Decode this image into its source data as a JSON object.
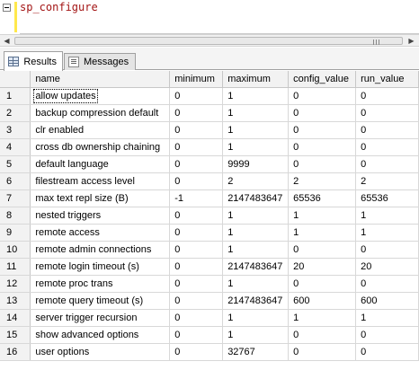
{
  "editor": {
    "collapse_symbol": "-",
    "query_text": "sp_configure"
  },
  "scrollbar": {
    "left_arrow": "◀",
    "right_arrow": "▶"
  },
  "tabs": [
    {
      "label": "Results",
      "icon": "grid-icon",
      "active": true
    },
    {
      "label": "Messages",
      "icon": "messages-icon",
      "active": false
    }
  ],
  "grid": {
    "columns": [
      "",
      "name",
      "minimum",
      "maximum",
      "config_value",
      "run_value"
    ],
    "rows": [
      [
        "1",
        "allow updates",
        "0",
        "1",
        "0",
        "0"
      ],
      [
        "2",
        "backup compression default",
        "0",
        "1",
        "0",
        "0"
      ],
      [
        "3",
        "clr enabled",
        "0",
        "1",
        "0",
        "0"
      ],
      [
        "4",
        "cross db ownership chaining",
        "0",
        "1",
        "0",
        "0"
      ],
      [
        "5",
        "default language",
        "0",
        "9999",
        "0",
        "0"
      ],
      [
        "6",
        "filestream access level",
        "0",
        "2",
        "2",
        "2"
      ],
      [
        "7",
        "max text repl size (B)",
        "-1",
        "2147483647",
        "65536",
        "65536"
      ],
      [
        "8",
        "nested triggers",
        "0",
        "1",
        "1",
        "1"
      ],
      [
        "9",
        "remote access",
        "0",
        "1",
        "1",
        "1"
      ],
      [
        "10",
        "remote admin connections",
        "0",
        "1",
        "0",
        "0"
      ],
      [
        "11",
        "remote login timeout (s)",
        "0",
        "2147483647",
        "20",
        "20"
      ],
      [
        "12",
        "remote proc trans",
        "0",
        "1",
        "0",
        "0"
      ],
      [
        "13",
        "remote query timeout (s)",
        "0",
        "2147483647",
        "600",
        "600"
      ],
      [
        "14",
        "server trigger recursion",
        "0",
        "1",
        "1",
        "1"
      ],
      [
        "15",
        "show advanced options",
        "0",
        "1",
        "0",
        "0"
      ],
      [
        "16",
        "user options",
        "0",
        "32767",
        "0",
        "0"
      ]
    ]
  },
  "colors": {
    "query_text": "#a31515",
    "modified_marker": "#ffe84c",
    "header_bg": "#f2f2f2"
  }
}
